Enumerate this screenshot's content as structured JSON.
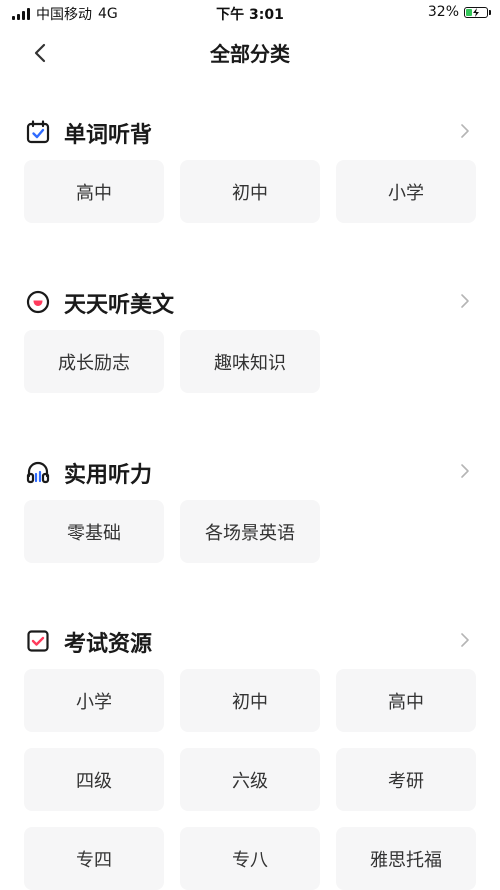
{
  "status_bar": {
    "carrier": "中国移动",
    "network": "4G",
    "time": "下午 3:01",
    "battery_percent": "32%",
    "battery_level": 0.32
  },
  "nav": {
    "title": "全部分类",
    "back_icon": "chevron-left-icon"
  },
  "sections": [
    {
      "title": "单词听背",
      "icon": "calendar-check-icon",
      "items": [
        "高中",
        "初中",
        "小学"
      ]
    },
    {
      "title": "天天听美文",
      "icon": "heart-circle-icon",
      "items": [
        "成长励志",
        "趣味知识"
      ]
    },
    {
      "title": "实用听力",
      "icon": "headphones-icon",
      "items": [
        "零基础",
        "各场景英语"
      ]
    },
    {
      "title": "考试资源",
      "icon": "checklist-icon",
      "items": [
        "小学",
        "初中",
        "高中",
        "四级",
        "六级",
        "考研",
        "专四",
        "专八",
        "雅思托福"
      ]
    }
  ],
  "colors": {
    "accent_blue": "#2f6bff",
    "accent_red": "#ff3b5c",
    "chip_bg": "#f6f6f7"
  }
}
